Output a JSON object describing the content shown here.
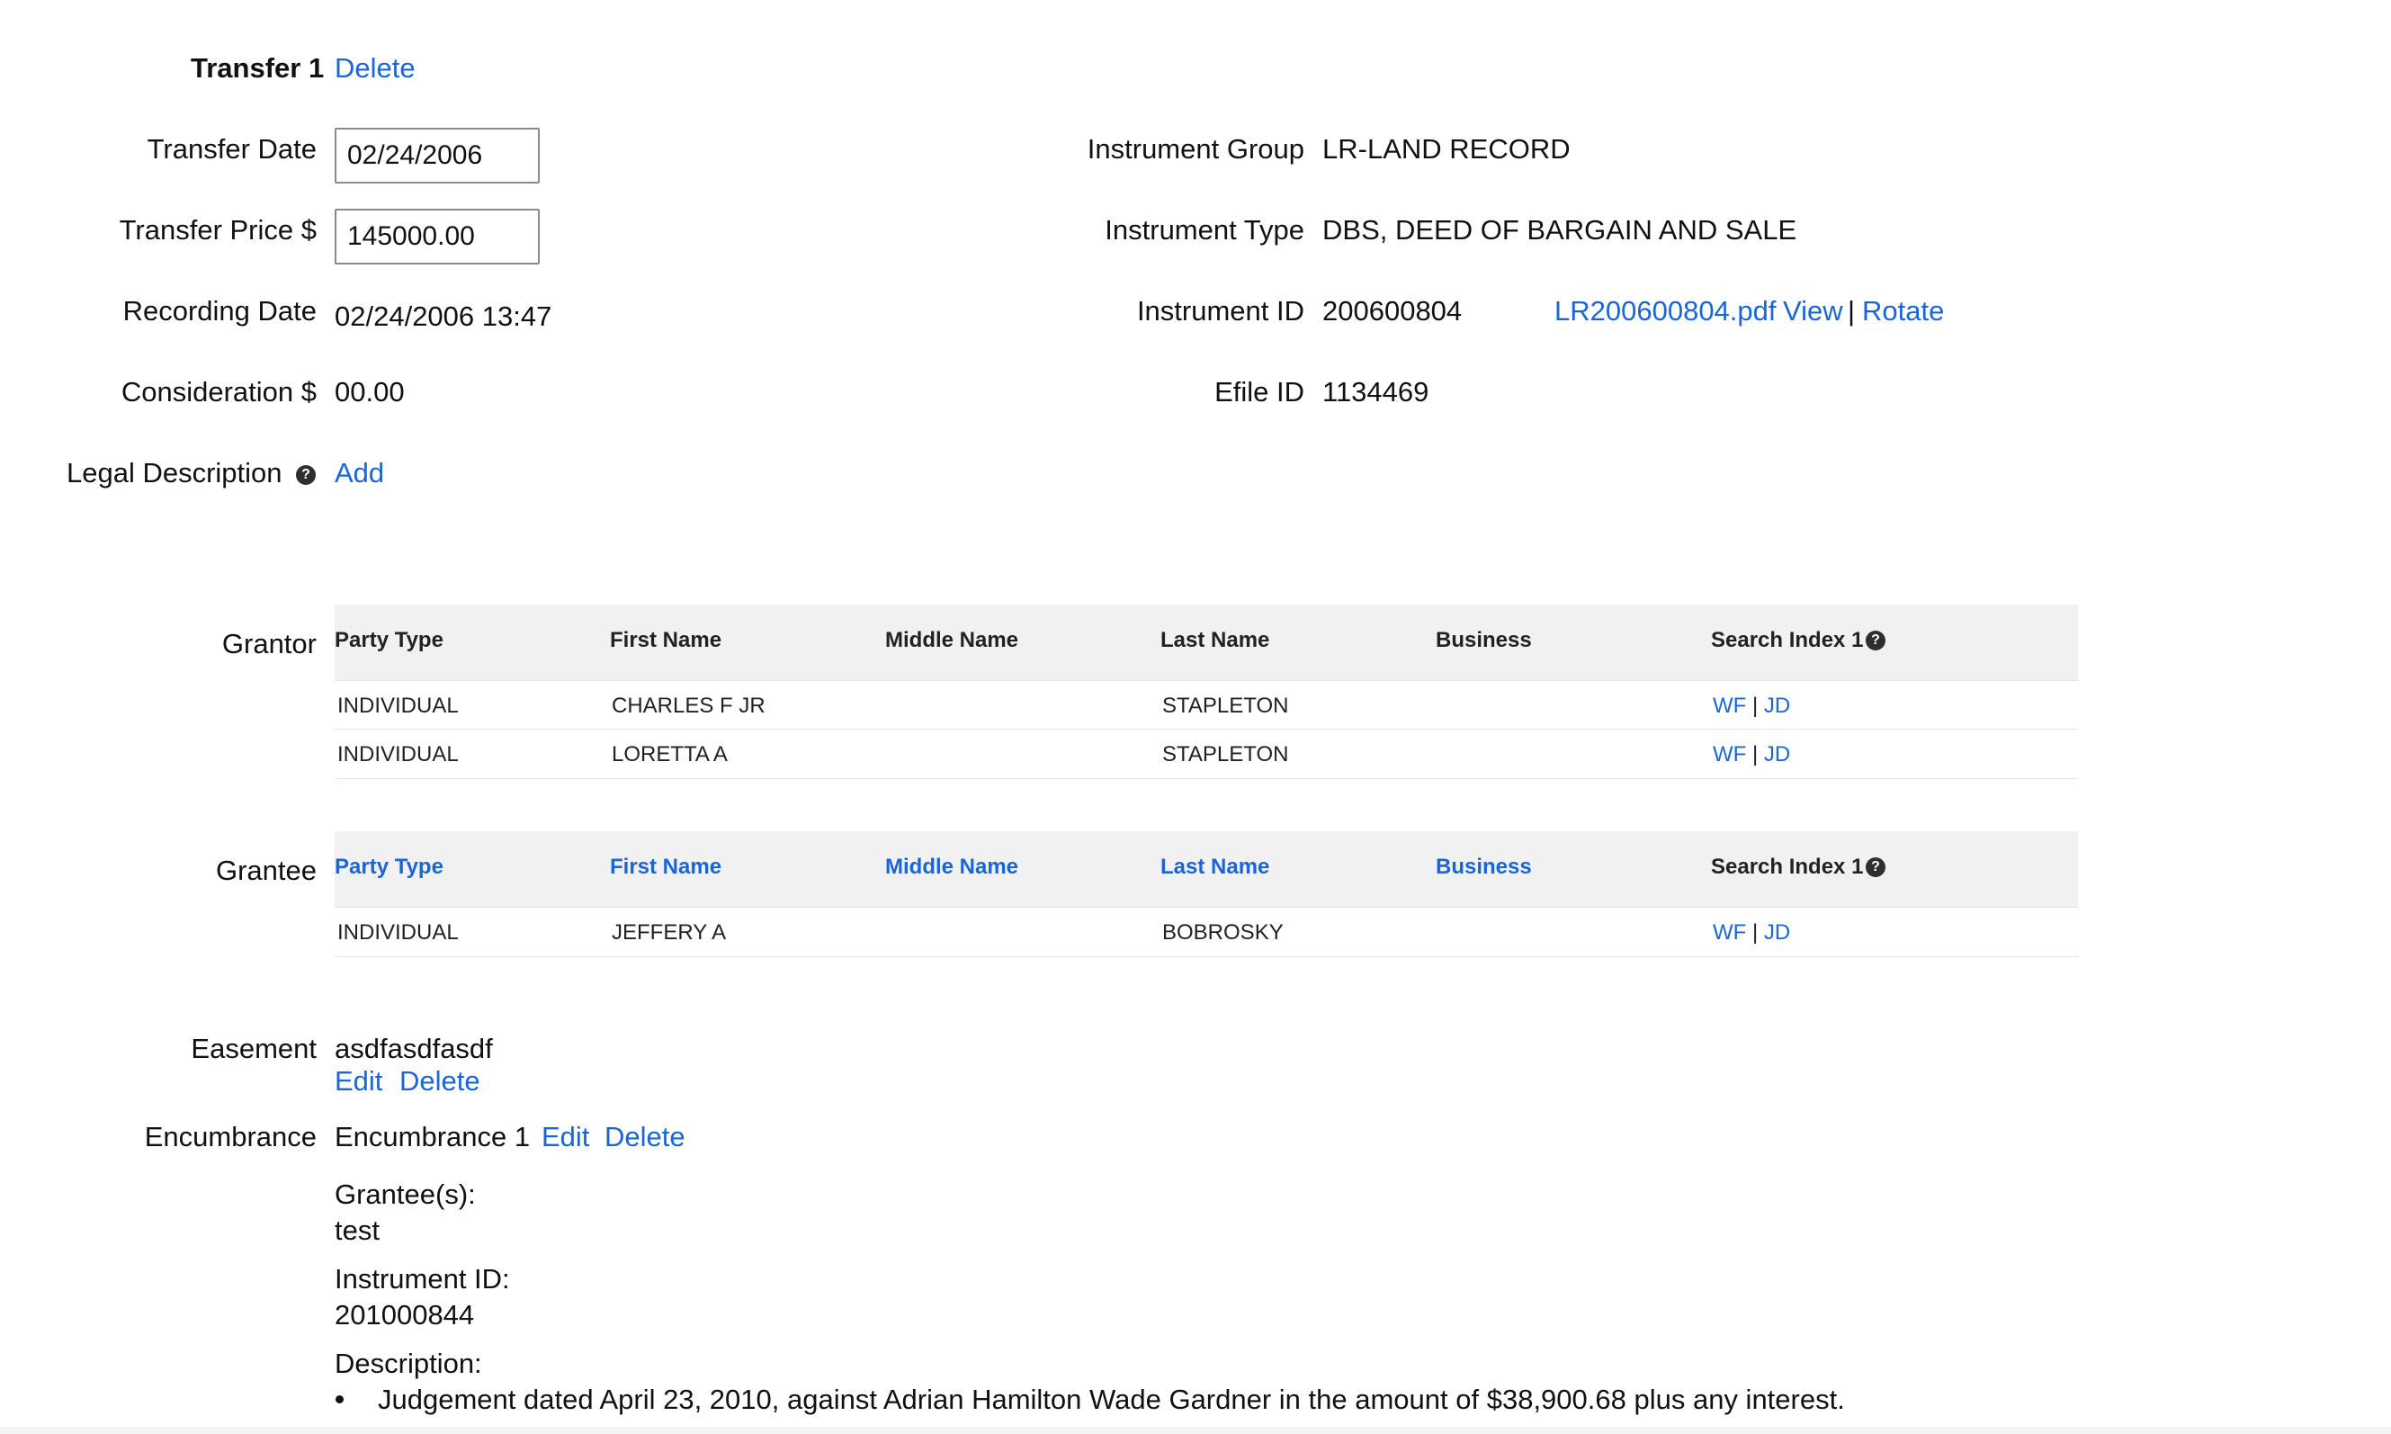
{
  "transfer": {
    "title": "Transfer 1",
    "delete_label": "Delete",
    "date_label": "Transfer Date",
    "date_value": "02/24/2006",
    "price_label": "Transfer Price $",
    "price_value": "145000.00",
    "recording_label": "Recording Date",
    "recording_value": "02/24/2006 13:47",
    "consideration_label": "Consideration $",
    "consideration_value": "00.00",
    "legal_label": "Legal Description",
    "legal_add": "Add"
  },
  "instrument": {
    "group_label": "Instrument Group",
    "group_value": "LR-LAND RECORD",
    "type_label": "Instrument Type",
    "type_value": "DBS, DEED OF BARGAIN AND SALE",
    "id_label": "Instrument ID",
    "id_value": "200600804",
    "pdf_link": "LR200600804.pdf",
    "view_link": "View",
    "sep": "|",
    "rotate_link": "Rotate",
    "efile_label": "Efile ID",
    "efile_value": "1134469"
  },
  "help_glyph": "?",
  "grantor": {
    "label": "Grantor",
    "headers": [
      "Party Type",
      "First Name",
      "Middle Name",
      "Last Name",
      "Business",
      "Search Index 1"
    ],
    "rows": [
      {
        "party": "INDIVIDUAL",
        "first": "CHARLES F JR",
        "middle": "",
        "last": "STAPLETON",
        "business": "",
        "wf": "WF",
        "sep": "|",
        "jd": "JD"
      },
      {
        "party": "INDIVIDUAL",
        "first": "LORETTA A",
        "middle": "",
        "last": "STAPLETON",
        "business": "",
        "wf": "WF",
        "sep": "|",
        "jd": "JD"
      }
    ]
  },
  "grantee": {
    "label": "Grantee",
    "headers": [
      "Party Type",
      "First Name",
      "Middle Name",
      "Last Name",
      "Business",
      "Search Index 1"
    ],
    "rows": [
      {
        "party": "INDIVIDUAL",
        "first": "JEFFERY A",
        "middle": "",
        "last": "BOBROSKY",
        "business": "",
        "wf": "WF",
        "sep": "|",
        "jd": "JD"
      }
    ]
  },
  "easement": {
    "label": "Easement",
    "value": "asdfasdfasdf",
    "edit": "Edit",
    "delete": "Delete"
  },
  "encumbrance": {
    "label": "Encumbrance",
    "title": "Encumbrance 1",
    "edit": "Edit",
    "delete": "Delete",
    "grantees_label": "Grantee(s):",
    "grantees_value": "test",
    "instrument_label": "Instrument ID:",
    "instrument_value": "201000844",
    "description_label": "Description:",
    "description_items": [
      "Judgement dated April 23, 2010, against Adrian Hamilton Wade Gardner in the amount of $38,900.68 plus any interest."
    ]
  },
  "colors": {
    "link": "#1a66d6",
    "table_header_bg": "#f1f1f1",
    "text": "#111111"
  }
}
